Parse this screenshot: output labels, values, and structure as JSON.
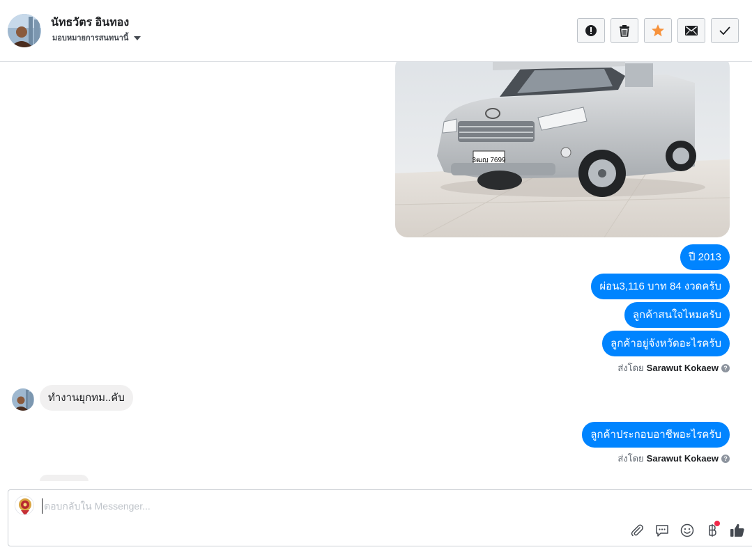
{
  "header": {
    "contact_name": "นัทธวัตร อินทอง",
    "assign_label": "มอบหมายการสนทนานี้"
  },
  "actions": [
    {
      "name": "mark-spam",
      "icon": "exclamation-circle-icon"
    },
    {
      "name": "delete",
      "icon": "trash-icon"
    },
    {
      "name": "star",
      "icon": "star-icon",
      "color": "#f7923b"
    },
    {
      "name": "mark-unread",
      "icon": "envelope-icon"
    },
    {
      "name": "mark-done",
      "icon": "check-icon"
    }
  ],
  "messages": {
    "out_1": [
      "ปี 2013",
      "ผ่อน3,116 บาท 84 งวดครับ",
      "ลูกค้าสนใจไหมครับ",
      "ลูกค้าอยู่จังหวัดอะไรครับ"
    ],
    "sent_by_prefix": "ส่งโดย",
    "sent_by_name": "Sarawut Kokaew",
    "in_1": "ทำงานยุกทม..คับ",
    "out_2": "ลูกค้าประกอบอาชีพอะไรครับ",
    "plate_text": "3ฒญ 7699"
  },
  "composer": {
    "placeholder": "ตอบกลับใน Messenger..."
  },
  "colors": {
    "outgoing_bubble": "#0084ff",
    "incoming_bubble": "#f1f0f0",
    "notification_dot": "#f02849"
  }
}
